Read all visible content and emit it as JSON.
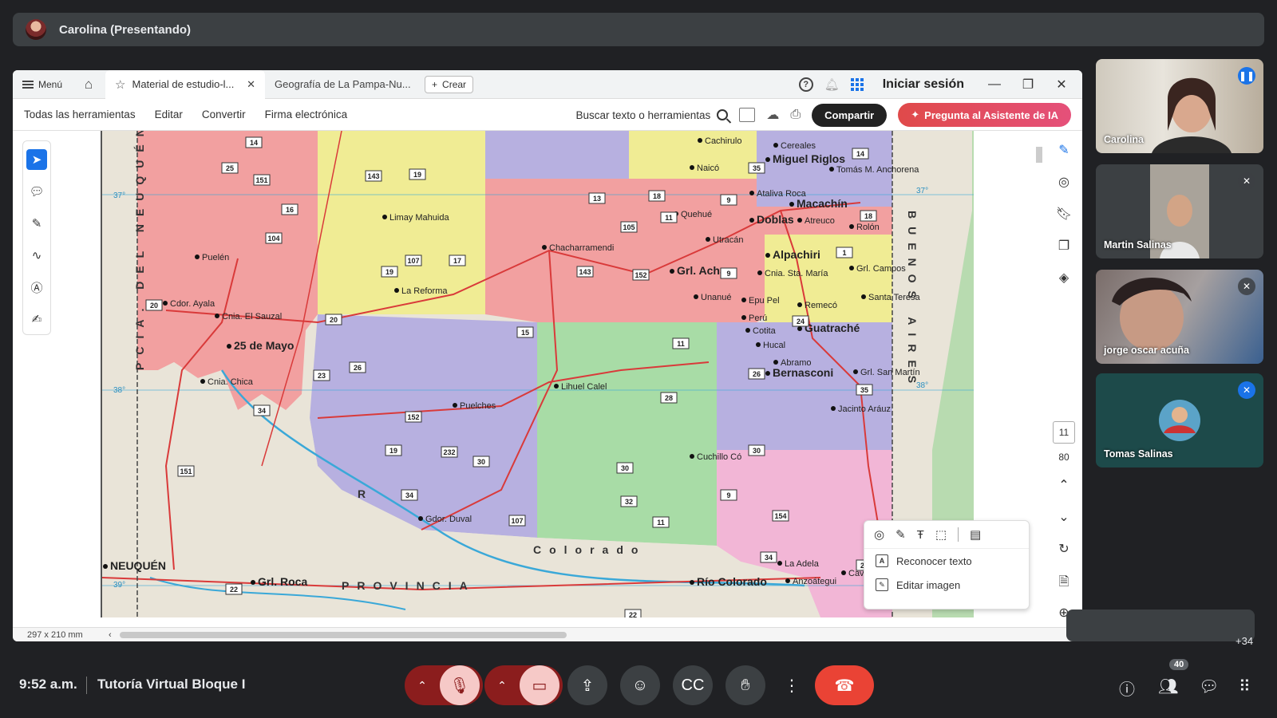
{
  "presenter": {
    "name": "Carolina (Presentando)"
  },
  "viewer": {
    "tabbar": {
      "menu_label": "Menú",
      "tabs": [
        {
          "label": "Material de estudio-l...",
          "active": true
        },
        {
          "label": "Geografía de La Pampa-Nu...",
          "active": false
        }
      ],
      "create_label": "Crear",
      "signin_label": "Iniciar sesión"
    },
    "toolbar": {
      "items": [
        "Todas las herramientas",
        "Editar",
        "Convertir",
        "Firma electrónica"
      ],
      "search_label": "Buscar texto o herramientas",
      "share_label": "Compartir",
      "ai_label": "Pregunta al Asistente de IA"
    },
    "page_number": "11",
    "page_total": "80",
    "page_size": "297 x 210 mm",
    "context_menu": {
      "items": [
        "Reconocer texto",
        "Editar imagen"
      ]
    }
  },
  "map": {
    "places": [
      "Cachirulo",
      "Cereales",
      "Miguel Riglos",
      "Tomás M. Anchorena",
      "Naicó",
      "Ataliva Roca",
      "Macachín",
      "Quehué",
      "Doblas",
      "Atreuco",
      "Rolón",
      "Limay Mahuida",
      "Utracán",
      "Chacharramendi",
      "Puelén",
      "Alpachiri",
      "Grl. Campos",
      "Grl. Acha",
      "Cnia. Sta. María",
      "La Reforma",
      "Unanué",
      "Epu Pel",
      "Santa Teresa",
      "Remecó",
      "Cdor. Ayala",
      "Cnia. El Sauzal",
      "Perú",
      "Cotita",
      "Guatraché",
      "25 de Mayo",
      "Hucal",
      "Abramo",
      "Grl. San Martín",
      "Bernasconi",
      "Cnia. Chica",
      "Lihuel Calel",
      "Jacinto Aráuz",
      "Puelches",
      "Cuchillo Có",
      "Gdor. Duval",
      "NEUQUÉN",
      "La Adela",
      "Anzoátegui",
      "Grl. Roca",
      "Río Colorado",
      "Caviotas"
    ],
    "province_labels": [
      "PCIA. DEL NEUQUÉN",
      "BUENOS AIRES",
      "PROVINCIA",
      "Colorado",
      "R"
    ],
    "route_numbers": [
      "14",
      "25",
      "151",
      "143",
      "19",
      "13",
      "18",
      "9",
      "35",
      "14",
      "16",
      "104",
      "105",
      "11",
      "18",
      "107",
      "17",
      "19",
      "143",
      "152",
      "9",
      "1",
      "20",
      "20",
      "24",
      "15",
      "11",
      "26",
      "23",
      "26",
      "28",
      "34",
      "152",
      "35",
      "19",
      "232",
      "30",
      "30",
      "151",
      "34",
      "30",
      "32",
      "9",
      "107",
      "11",
      "154",
      "34",
      "22",
      "22",
      "22"
    ],
    "latitudes": [
      "37°",
      "38°",
      "39°",
      "37°",
      "38°",
      "39°"
    ]
  },
  "participants": [
    {
      "name": "Carolina",
      "speaking": true
    },
    {
      "name": "Martin Salinas",
      "muted": true
    },
    {
      "name": "jorge oscar acuña",
      "muted": true
    },
    {
      "name": "Tomas Salinas",
      "muted": true
    }
  ],
  "more_participants": "+34",
  "meeting": {
    "time": "9:52 a.m.",
    "title": "Tutoría Virtual Bloque I",
    "participant_count": "40"
  },
  "colors": {
    "accent": "#1a73e8",
    "end_call": "#ea4335",
    "background": "#202124"
  }
}
